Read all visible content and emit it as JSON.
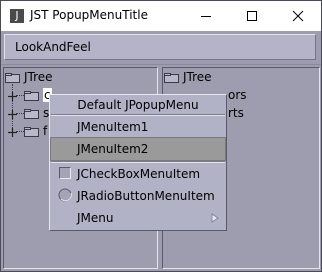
{
  "window": {
    "title": "JST PopupMenuTitle",
    "app_icon_glyph": "J"
  },
  "menubar": {
    "lookandfeel_label": "LookAndFeel"
  },
  "left_tree": {
    "root_label": "JTree",
    "children": [
      {
        "label": "c"
      },
      {
        "label": "s"
      },
      {
        "label": "f"
      }
    ]
  },
  "right_tree": {
    "root_label": "JTree",
    "children": [
      {
        "label": "ors"
      },
      {
        "label": "rts"
      }
    ]
  },
  "popup": {
    "title": "Default JPopupMenu",
    "items": [
      {
        "label": "JMenuItem1",
        "type": "item",
        "selected": false
      },
      {
        "label": "JMenuItem2",
        "type": "item",
        "selected": true
      },
      {
        "label": "JCheckBoxMenuItem",
        "type": "checkbox",
        "checked": false
      },
      {
        "label": "JRadioButtonMenuItem",
        "type": "radio",
        "checked": false
      },
      {
        "label": "JMenu",
        "type": "submenu"
      }
    ]
  },
  "colors": {
    "window_bg": "#9d9daf",
    "popup_bg": "#b2b2c6",
    "selected_item": "#9a9a9a"
  }
}
